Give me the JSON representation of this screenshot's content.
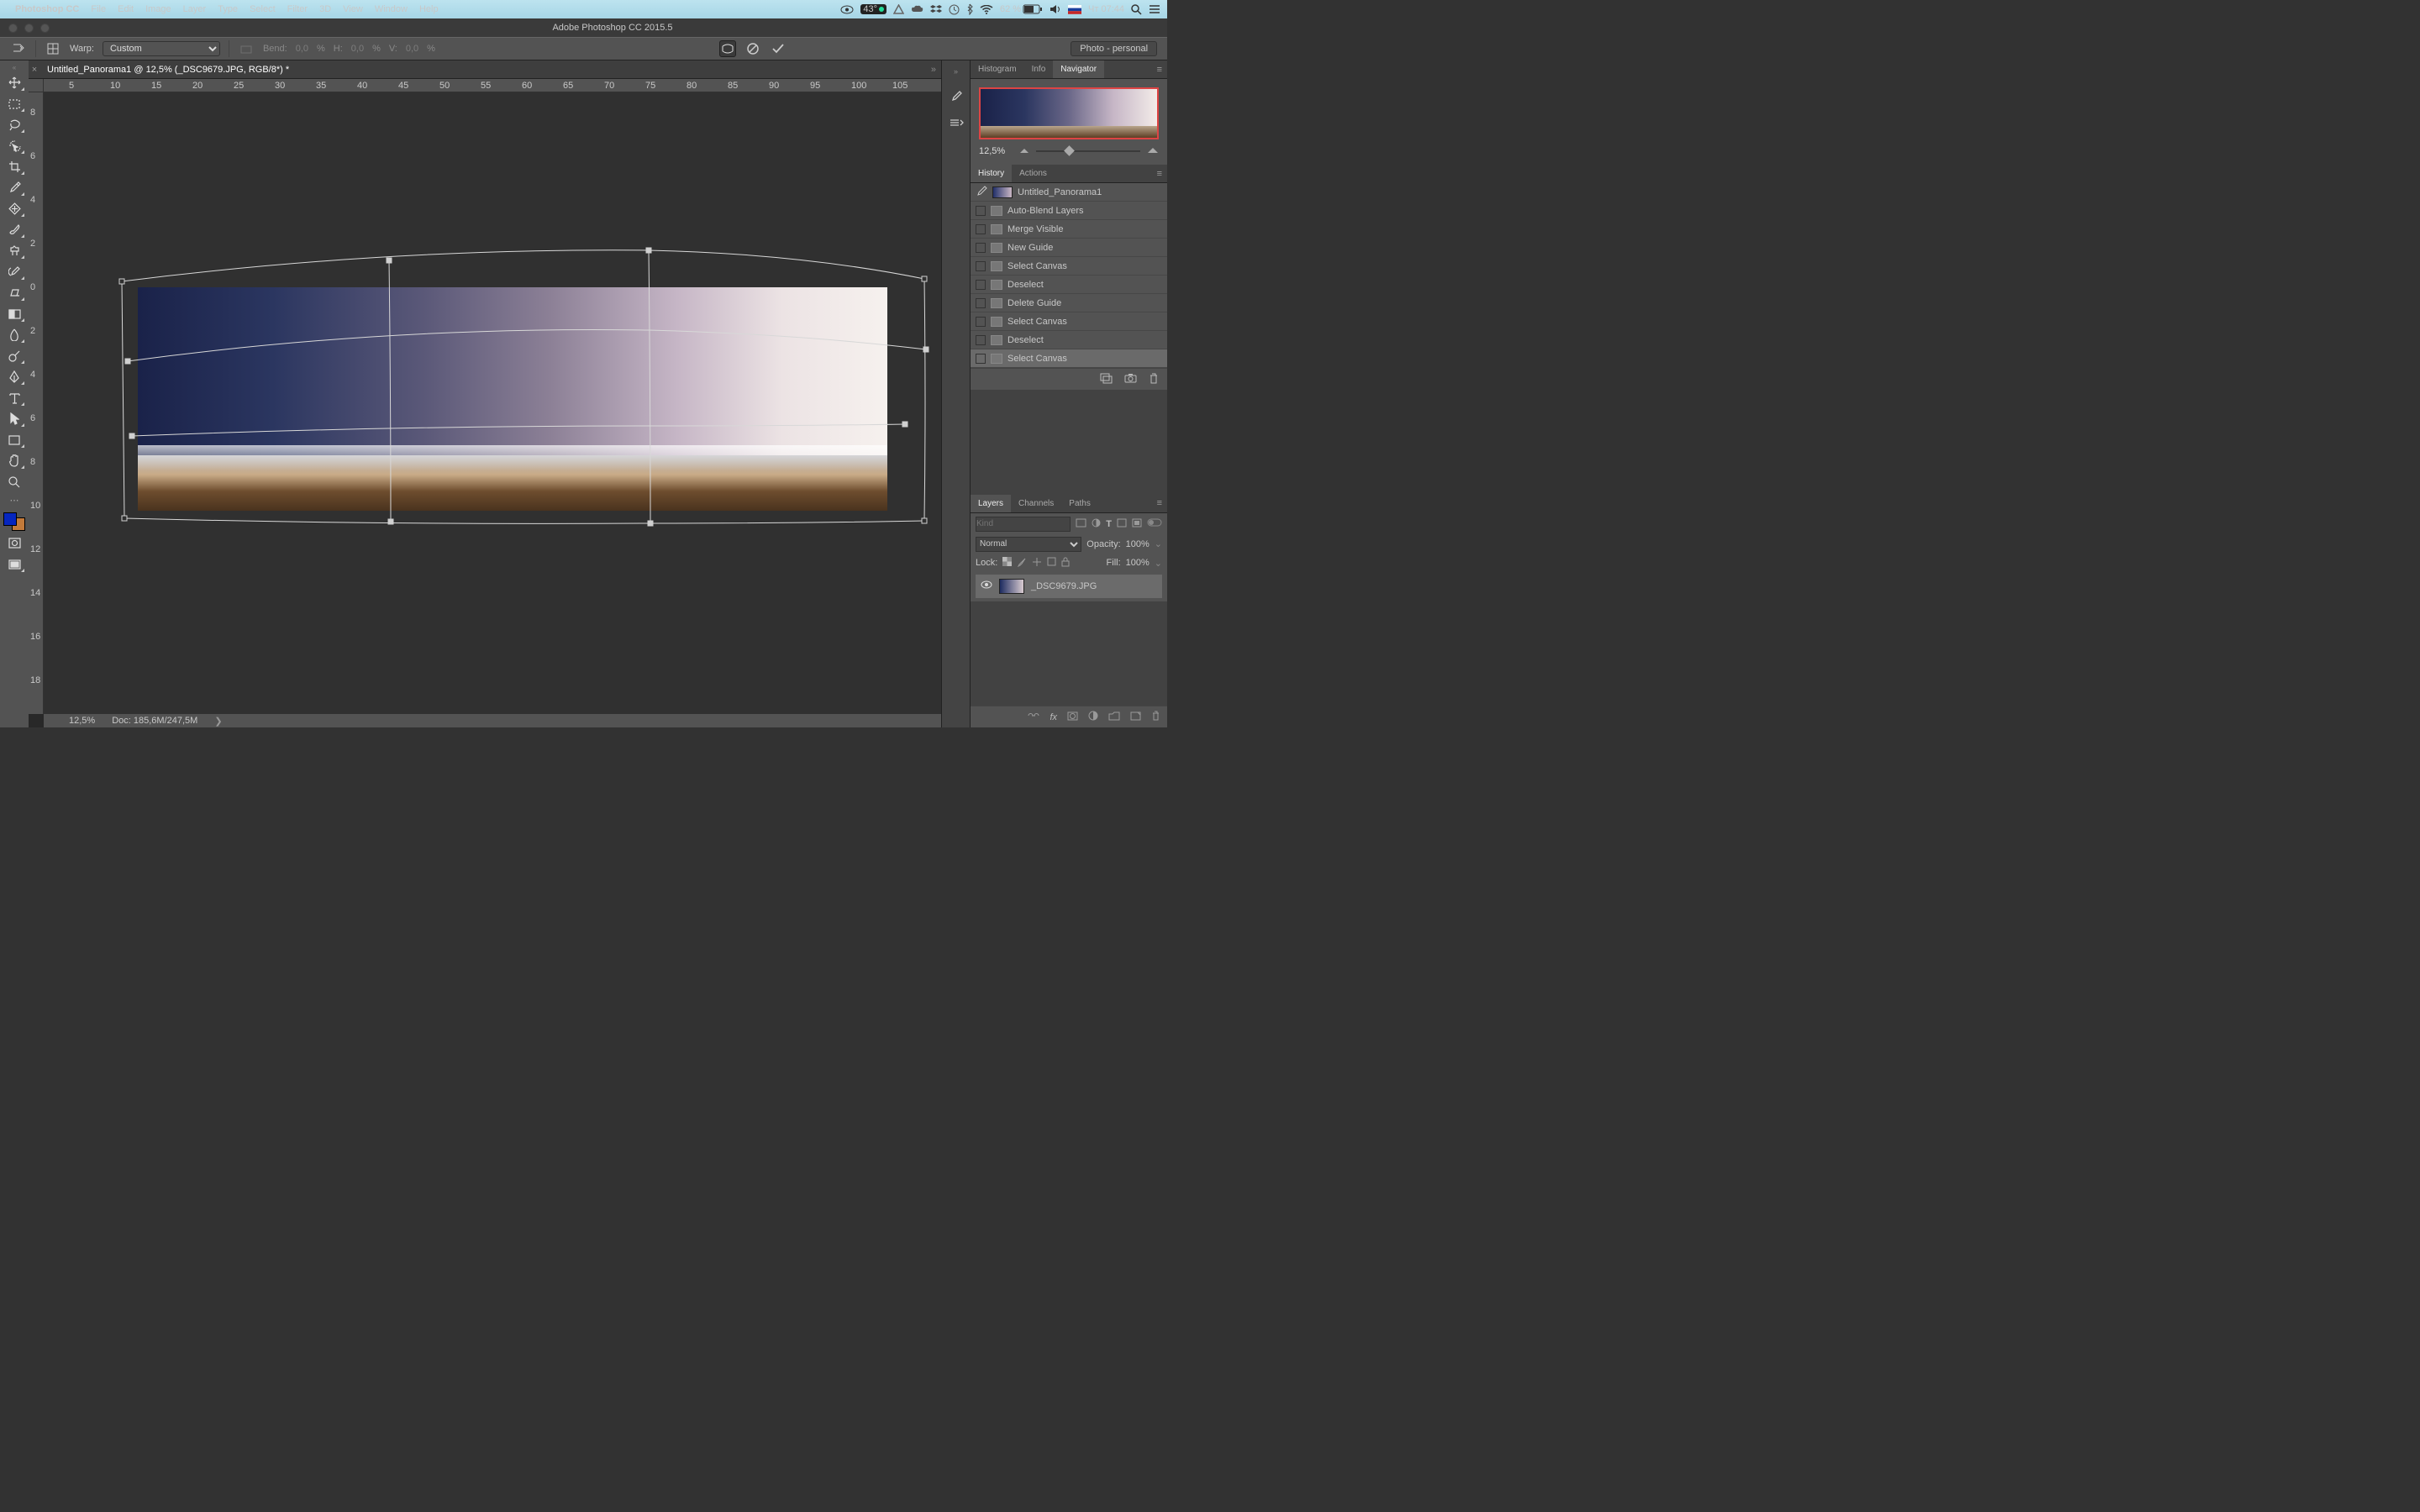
{
  "menubar": {
    "app": "Photoshop CC",
    "items": [
      "File",
      "Edit",
      "Image",
      "Layer",
      "Type",
      "Select",
      "Filter",
      "3D",
      "View",
      "Window",
      "Help"
    ],
    "temp": "43°",
    "battery": "62 %",
    "clock": "Чт 07:44"
  },
  "titlebar": {
    "title": "Adobe Photoshop CC 2015.5"
  },
  "optbar": {
    "warp_label": "Warp:",
    "warp_mode": "Custom",
    "bend_label": "Bend:",
    "bend_val": "0,0",
    "pct": "%",
    "h_label": "H:",
    "h_val": "0,0",
    "v_label": "V:",
    "v_val": "0,0",
    "workspace": "Photo - personal"
  },
  "doc": {
    "tab": "Untitled_Panorama1 @ 12,5% (_DSC9679.JPG, RGB/8*) *",
    "status_zoom": "12,5%",
    "status_doc": "Doc: 185,6M/247,5M",
    "hruler": [
      "5",
      "10",
      "15",
      "20",
      "25",
      "30",
      "35",
      "40",
      "45",
      "50",
      "55",
      "60",
      "65",
      "70",
      "75",
      "80",
      "85",
      "90",
      "95",
      "100",
      "105"
    ],
    "vruler": [
      "8",
      "6",
      "4",
      "2",
      "0",
      "2",
      "4",
      "6",
      "8",
      "10",
      "12",
      "14",
      "16",
      "18"
    ]
  },
  "nav": {
    "tabs": [
      "Histogram",
      "Info",
      "Navigator"
    ],
    "zoom": "12,5%"
  },
  "history": {
    "tabs": [
      "History",
      "Actions"
    ],
    "doc": "Untitled_Panorama1",
    "items": [
      "Auto-Blend Layers",
      "Merge Visible",
      "New Guide",
      "Select Canvas",
      "Deselect",
      "Delete Guide",
      "Select Canvas",
      "Deselect",
      "Select Canvas"
    ]
  },
  "layers": {
    "tabs": [
      "Layers",
      "Channels",
      "Paths"
    ],
    "filter_placeholder": "Kind",
    "blend": "Normal",
    "opacity_label": "Opacity:",
    "opacity": "100%",
    "lock_label": "Lock:",
    "fill_label": "Fill:",
    "fill": "100%",
    "layer_name": "_DSC9679.JPG"
  }
}
